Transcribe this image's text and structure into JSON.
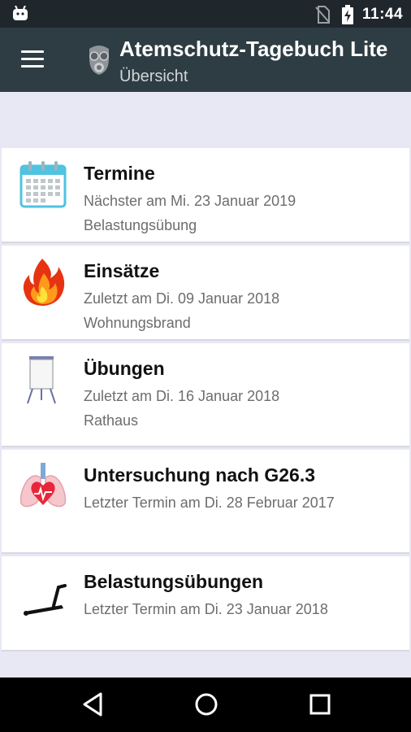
{
  "status_bar": {
    "time": "11:44"
  },
  "app_bar": {
    "title": "Atemschutz-Tagebuch Lite",
    "subtitle": "Übersicht"
  },
  "items": [
    {
      "title": "Termine",
      "line1": "Nächster am Mi. 23 Januar 2019",
      "line2": "Belastungsübung",
      "icon": "calendar-icon"
    },
    {
      "title": "Einsätze",
      "line1": "Zuletzt am Di. 09 Januar 2018",
      "line2": "Wohnungsbrand",
      "icon": "fire-icon"
    },
    {
      "title": "Übungen",
      "line1": "Zuletzt am Di. 16 Januar 2018",
      "line2": "Rathaus",
      "icon": "flipchart-icon"
    },
    {
      "title": "Untersuchung nach G26.3",
      "line1": "Letzter Termin am Di. 28 Februar 2017",
      "line2": "",
      "icon": "lungs-heart-icon"
    },
    {
      "title": "Belastungsübungen",
      "line1": "Letzter Termin am Di. 23 Januar 2018",
      "line2": "",
      "icon": "treadmill-icon"
    }
  ]
}
